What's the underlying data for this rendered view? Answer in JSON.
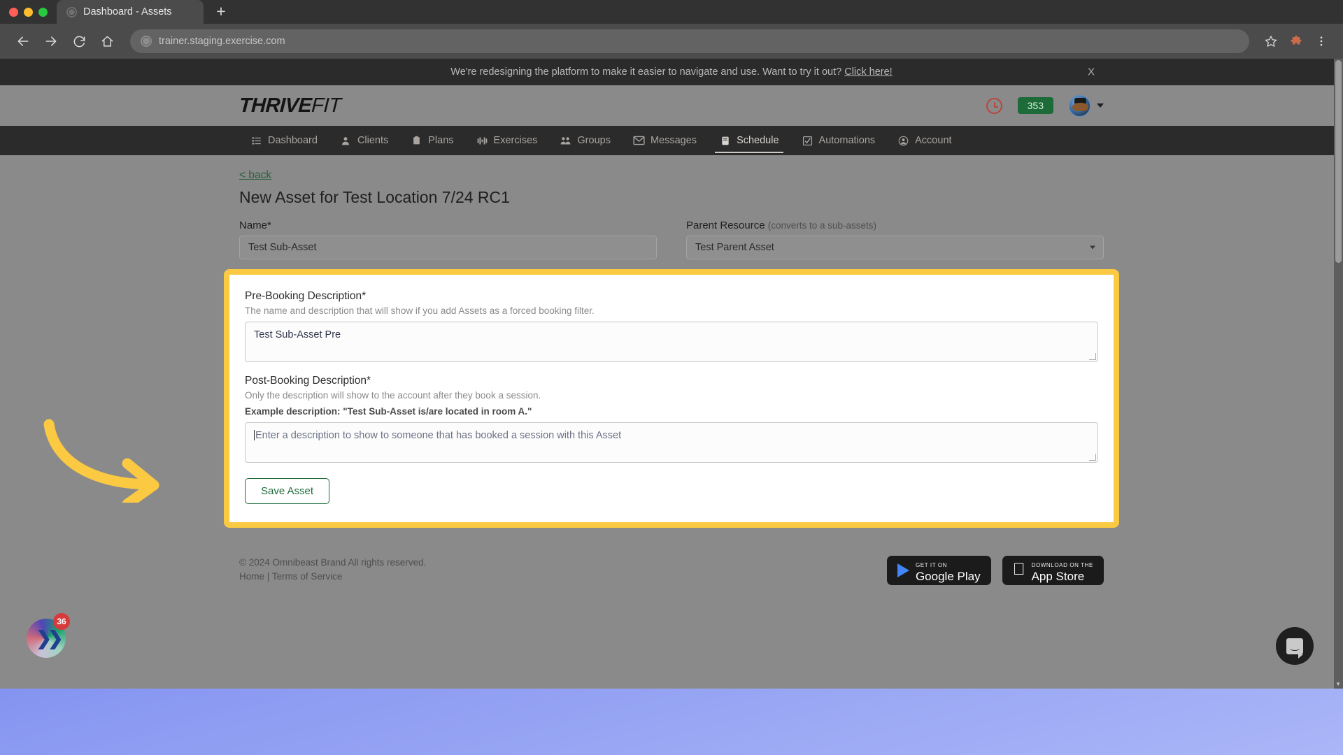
{
  "browser": {
    "tab_title": "Dashboard - Assets",
    "newtab_label": "+",
    "url": "trainer.staging.exercise.com",
    "back_icon": "back-arrow-icon",
    "forward_icon": "forward-arrow-icon",
    "reload_icon": "reload-icon",
    "home_icon": "home-icon",
    "bookmark_icon": "star-icon",
    "extensions_icon": "puzzle-icon",
    "menu_icon": "kebab-menu-icon"
  },
  "banner": {
    "text": "We're redesigning the platform to make it easier to navigate and use. Want to try it out?",
    "link": "Click here!",
    "close": "X"
  },
  "header": {
    "logo_bold": "THRIVE",
    "logo_light": "FIT",
    "credit_badge": "353",
    "clock_icon": "clock-icon",
    "avatar_icon": "user-avatar",
    "chevron_icon": "chevron-down-icon"
  },
  "nav": {
    "items": [
      {
        "label": "Dashboard",
        "icon": "list-icon",
        "active": false
      },
      {
        "label": "Clients",
        "icon": "person-icon",
        "active": false
      },
      {
        "label": "Plans",
        "icon": "clipboard-icon",
        "active": false
      },
      {
        "label": "Exercises",
        "icon": "barbell-icon",
        "active": false
      },
      {
        "label": "Groups",
        "icon": "people-icon",
        "active": false
      },
      {
        "label": "Messages",
        "icon": "envelope-icon",
        "active": false
      },
      {
        "label": "Schedule",
        "icon": "calendar-icon",
        "active": true
      },
      {
        "label": "Automations",
        "icon": "checkbox-icon",
        "active": false
      },
      {
        "label": "Account",
        "icon": "user-circle-icon",
        "active": false
      }
    ]
  },
  "main": {
    "back_link": "< back",
    "page_title": "New Asset for Test Location 7/24 RC1",
    "name_field": {
      "label": "Name*",
      "value": "Test Sub-Asset"
    },
    "parent_resource": {
      "label": "Parent Resource",
      "hint": "(converts to a sub-assets)",
      "value": "Test Parent Asset"
    },
    "pre_booking": {
      "label": "Pre-Booking Description*",
      "sub": "The name and description that will show if you add Assets as a forced booking filter.",
      "value": "Test Sub-Asset Pre"
    },
    "post_booking": {
      "label": "Post-Booking Description*",
      "sub": "Only the description will show to the account after they book a session.",
      "example": "Example description: \"Test Sub-Asset is/are located in room A.\"",
      "placeholder": "Enter a description to show to someone that has booked a session with this Asset",
      "value": ""
    },
    "save_button": "Save Asset",
    "highlight_color": "#fbc942"
  },
  "footer": {
    "copyright": "© 2024 Omnibeast Brand All rights reserved.",
    "home_link": "Home",
    "separator": "|",
    "terms_link": "Terms of Service",
    "google_play": {
      "top": "GET IT ON",
      "bottom": "Google Play"
    },
    "app_store": {
      "top": "Download on the",
      "bottom": "App Store"
    }
  },
  "widgets": {
    "launcher_badge": "36",
    "launcher_icon": "brand-chevrons-icon",
    "chat_icon": "chat-bubble-icon"
  }
}
